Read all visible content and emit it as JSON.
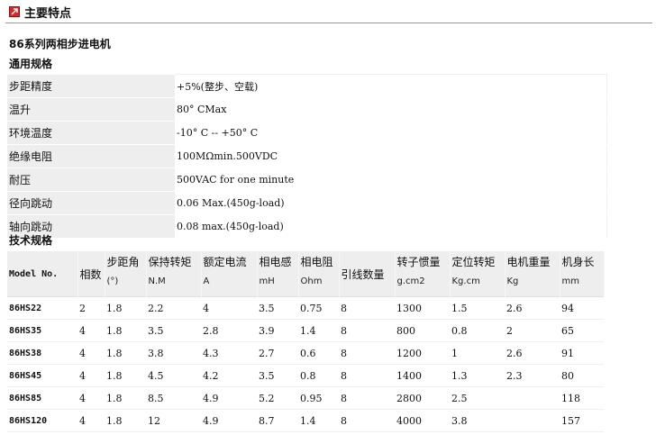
{
  "header": {
    "title": "主要特点"
  },
  "subtitle": "86系列两相步进电机",
  "general_title": "通用规格",
  "general_specs": [
    {
      "label": "步距精度",
      "value": "+5%(整步、空载)"
    },
    {
      "label": "温升",
      "value": "80° CMax"
    },
    {
      "label": "环境温度",
      "value": "-10° C -- +50° C"
    },
    {
      "label": "绝缘电阻",
      "value": "100MΩmin.500VDC"
    },
    {
      "label": "耐压",
      "value": "500VAC for one minute"
    },
    {
      "label": "径向跳动",
      "value": "0.06 Max.(450g-load)"
    },
    {
      "label": "轴向跳动",
      "value": "0.08 max.(450g-load)"
    }
  ],
  "tech_title": "技术规格",
  "tech_table": {
    "model_header": "Model No.",
    "phase_header": "相数",
    "wire_header": "引线数量",
    "columns": [
      {
        "name": "步距角",
        "unit": "(°)"
      },
      {
        "name": "保持转矩",
        "unit": "N.M"
      },
      {
        "name": "额定电流",
        "unit": "A"
      },
      {
        "name": "相电感",
        "unit": "mH"
      },
      {
        "name": "相电阻",
        "unit": "Ohm"
      },
      {
        "name": "转子惯量",
        "unit": "g.cm2"
      },
      {
        "name": "定位转矩",
        "unit": "Kg.cm"
      },
      {
        "name": "电机重量",
        "unit": "Kg"
      },
      {
        "name": "机身长",
        "unit": "mm"
      }
    ],
    "rows": [
      [
        "86HS22",
        "2",
        "1.8",
        "2.2",
        "4",
        "3.5",
        "0.75",
        "8",
        "1300",
        "1.5",
        "2.6",
        "94"
      ],
      [
        "86HS35",
        "4",
        "1.8",
        "3.5",
        "2.8",
        "3.9",
        "1.4",
        "8",
        "800",
        "0.8",
        "2",
        "65"
      ],
      [
        "86HS38",
        "4",
        "1.8",
        "3.8",
        "4.3",
        "2.7",
        "0.6",
        "8",
        "1200",
        "1",
        "2.6",
        "91"
      ],
      [
        "86HS45",
        "4",
        "1.8",
        "4.5",
        "4.2",
        "3.5",
        "0.8",
        "8",
        "1400",
        "1.3",
        "2.3",
        "80"
      ],
      [
        "86HS85",
        "4",
        "1.8",
        "8.5",
        "4.9",
        "5.2",
        "0.95",
        "8",
        "2800",
        "2.5",
        "",
        "118"
      ],
      [
        "86HS120",
        "4",
        "1.8",
        "12",
        "4.9",
        "8.7",
        "1.4",
        "8",
        "4000",
        "3.8",
        "",
        "157"
      ]
    ]
  }
}
